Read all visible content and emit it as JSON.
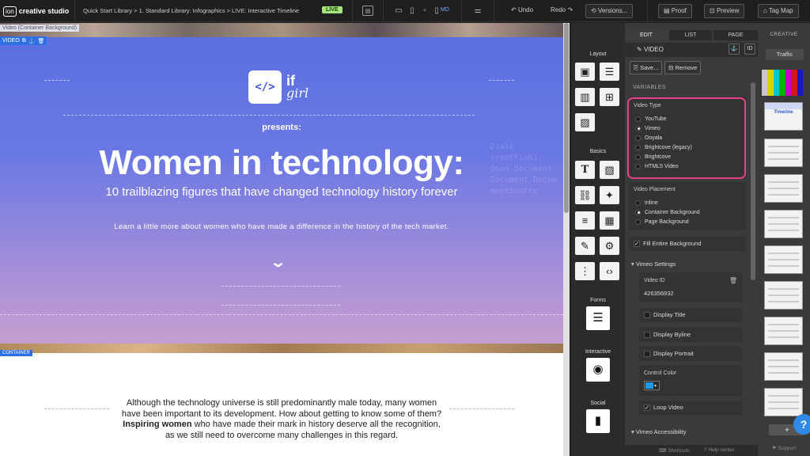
{
  "app": {
    "logo_icon": "ion",
    "logo_name": "creative studio"
  },
  "breadcrumb": "Quick Start Library > 1. Standard Library: Infographics > LIVE: Interactive Timeline",
  "live_badge": "LIVE",
  "device": {
    "md_label": "MD"
  },
  "toolbar": {
    "undo": "Undo",
    "redo": "Redo",
    "versions": "Versions...",
    "proof": "Proof",
    "preview": "Preview",
    "tagmap": "Tag Map"
  },
  "canvas": {
    "video_label": "Video (Container Background)",
    "video_badge": "VIDEO",
    "brand_icon": "</>",
    "brand_if": "if",
    "brand_girl": "girl",
    "presents": "presents:",
    "title": "Women in technology:",
    "subtitle": "10 trailblazing figures that have changed technology history forever",
    "tagline": "Learn a little more about women who have made a difference in the history of the tech market.",
    "container_label": "CONTAINER",
    "para_1": "Although the technology universe is still predominantly male today, many women have been important to its development. How about getting to know some of them?",
    "para_bold": "Inspiring women",
    "para_2": "who have made their mark in history deserve all the recognition, as we still need to overcome many challenges in this regard."
  },
  "palette": {
    "layout": "Layout",
    "basics": "Basics",
    "forms": "Forms",
    "interactive": "Interactive",
    "social": "Social"
  },
  "panel": {
    "tabs": [
      "EDIT",
      "LIST",
      "PAGE"
    ],
    "header": "VIDEO",
    "id_btn": "ID",
    "save": "Save...",
    "remove": "Remove",
    "variables": "VARIABLES",
    "video_type_label": "Video Type",
    "video_types": [
      "YouTube",
      "Vimeo",
      "Ooyala",
      "Brightcove (legacy)",
      "Brightcove",
      "HTML5 Video"
    ],
    "video_type_selected": "Vimeo",
    "placement_label": "Video Placement",
    "placements": [
      "Inline",
      "Container Background",
      "Page Background"
    ],
    "placement_selected": "Container Background",
    "fill_bg": "Fill Entire Background",
    "vimeo_settings": "Vimeo Settings",
    "video_id_label": "Video ID",
    "video_id": "426356932",
    "display_title": "Display Title",
    "display_byline": "Display Byline",
    "display_portrait": "Display Portrait",
    "control_color_label": "Control Color",
    "control_color": "#1e9be8",
    "loop_video": "Loop Video",
    "vimeo_accessibility": "Vimeo Accessibility",
    "shortcuts": "Shortcuts",
    "help_center": "Help center",
    "support": "Support"
  },
  "pages": {
    "creative": "CREATIVE",
    "traffic": "Traffic",
    "timeline_thumb": "Timeline",
    "add": "+"
  },
  "help": "?"
}
